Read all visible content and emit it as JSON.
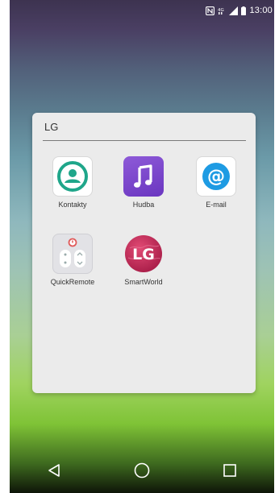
{
  "status_bar": {
    "icons": [
      "nfc-icon",
      "wifi-signal-icon",
      "cell-signal-icon",
      "battery-icon"
    ],
    "time": "13:00"
  },
  "folder": {
    "title": "LG",
    "apps": [
      {
        "name": "Kontakty",
        "icon": "contacts-icon"
      },
      {
        "name": "Hudba",
        "icon": "music-icon"
      },
      {
        "name": "E-mail",
        "icon": "email-icon"
      },
      {
        "name": "QuickRemote",
        "icon": "remote-icon"
      },
      {
        "name": "SmartWorld",
        "icon": "smartworld-icon"
      }
    ]
  },
  "smartworld_logo_text": "LG",
  "nav_bar": {
    "buttons": [
      "back-icon",
      "home-icon",
      "recents-icon"
    ]
  },
  "colors": {
    "music_purple": "#7a45cc",
    "contacts_green": "#1fa68a",
    "email_blue": "#1e9be3",
    "smartworld_red": "#c62b58",
    "remote_red": "#e05a5a"
  }
}
